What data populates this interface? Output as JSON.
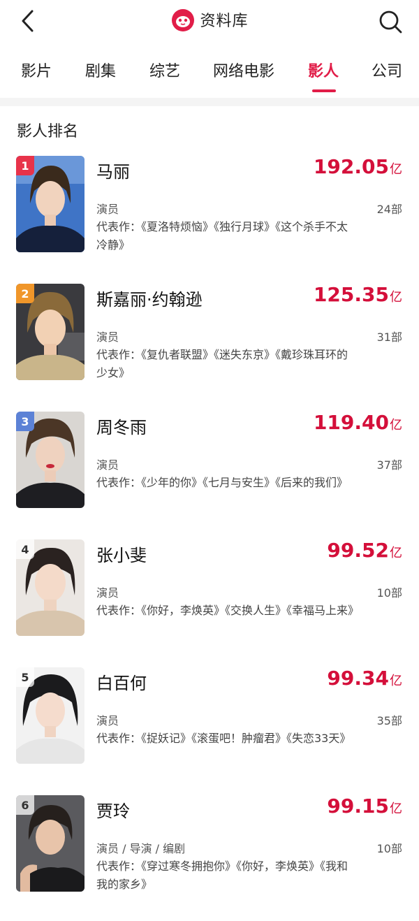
{
  "header": {
    "title": "资料库",
    "logo": "cat-logo",
    "back_icon": "back-arrow-icon",
    "search_icon": "search-icon"
  },
  "tabs": [
    {
      "label": "影片"
    },
    {
      "label": "剧集"
    },
    {
      "label": "综艺"
    },
    {
      "label": "网络电影"
    },
    {
      "label": "影人",
      "active": true
    },
    {
      "label": "公司"
    }
  ],
  "section": {
    "title": "影人排名"
  },
  "colors": {
    "accent": "#e11d48",
    "gross": "#d40f3a",
    "rank1": "#e8334a",
    "rank2": "#f0962a",
    "rank3": "#5c82d6"
  },
  "people": [
    {
      "rank": "1",
      "name": "马丽",
      "gross": "192.05",
      "unit": "亿",
      "role": "演员",
      "count": "24部",
      "works": "代表作：《夏洛特烦恼》《独行月球》《这个杀手不太冷静》"
    },
    {
      "rank": "2",
      "name": "斯嘉丽·约翰逊",
      "gross": "125.35",
      "unit": "亿",
      "role": "演员",
      "count": "31部",
      "works": "代表作：《复仇者联盟》《迷失东京》《戴珍珠耳环的少女》"
    },
    {
      "rank": "3",
      "name": "周冬雨",
      "gross": "119.40",
      "unit": "亿",
      "role": "演员",
      "count": "37部",
      "works": "代表作：《少年的你》《七月与安生》《后来的我们》"
    },
    {
      "rank": "4",
      "name": "张小斐",
      "gross": "99.52",
      "unit": "亿",
      "role": "演员",
      "count": "10部",
      "works": "代表作：《你好，李焕英》《交换人生》《幸福马上来》"
    },
    {
      "rank": "5",
      "name": "白百何",
      "gross": "99.34",
      "unit": "亿",
      "role": "演员",
      "count": "35部",
      "works": "代表作：《捉妖记》《滚蛋吧！肿瘤君》《失恋33天》"
    },
    {
      "rank": "6",
      "name": "贾玲",
      "gross": "99.15",
      "unit": "亿",
      "role": "演员 / 导演 / 编剧",
      "count": "10部",
      "works": "代表作：《穿过寒冬拥抱你》《你好，李焕英》《我和我的家乡》"
    }
  ]
}
